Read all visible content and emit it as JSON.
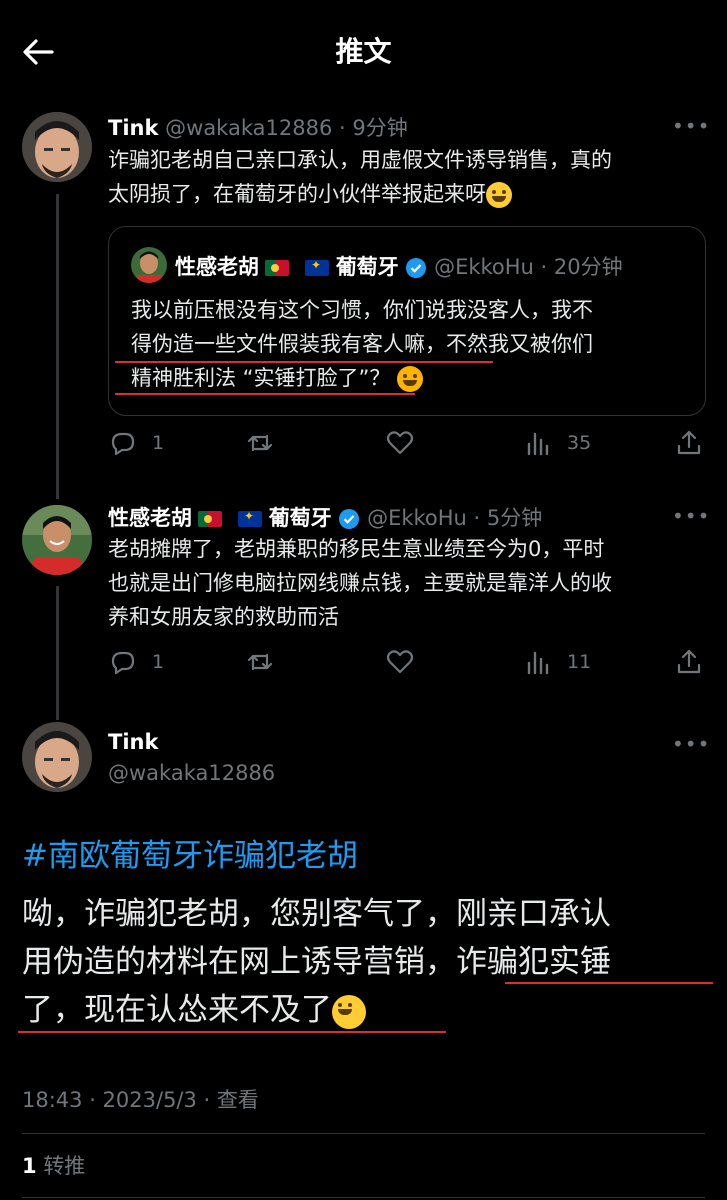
{
  "header": {
    "title": "推文"
  },
  "tweet1": {
    "name": "Tink",
    "handle_time": "@wakaka12886 · 9分钟",
    "text_line1": "诈骗犯老胡自己亲口承认，用虚假文件诱导销售，真的",
    "text_line2": "太阴损了，在葡萄牙的小伙伴举报起来呀",
    "more": "•••",
    "quote": {
      "name": "性感老胡",
      "name2": "葡萄牙",
      "handle_time": "@EkkoHu · 20分钟",
      "line1": "我以前压根没有这个习惯，你们说我没客人，我不",
      "line2": "得伪造一些文件假装我有客人嘛，不然我又被你们",
      "line3": "精神胜利法 “实锤打脸了”？"
    },
    "actions": {
      "replies": "1",
      "views": "35"
    }
  },
  "tweet2": {
    "name": "性感老胡",
    "name2": "葡萄牙",
    "handle_time": "@EkkoHu · 5分钟",
    "text_line1": "老胡摊牌了，老胡兼职的移民生意业绩至今为0，平时",
    "text_line2": "也就是出门修电脑拉网线赚点钱，主要就是靠洋人的收",
    "text_line3": "养和女朋友家的救助而活",
    "more": "•••",
    "actions": {
      "replies": "1",
      "views": "11"
    }
  },
  "main_tweet": {
    "name": "Tink",
    "handle": "@wakaka12886",
    "more": "•••",
    "hashtag": "#南欧葡萄牙诈骗犯老胡",
    "line1": "呦，诈骗犯老胡，您别客气了，刚亲口承认",
    "line2": "用伪造的材料在网上诱导营销，诈骗犯实锤",
    "line3": "了，现在认怂来不及了",
    "timestamp": "18:43 · 2023/5/3 · 查看",
    "retweet_count": "1",
    "retweet_label": "转推"
  },
  "colors": {
    "background": "#000000",
    "text": "#e7e9ea",
    "muted": "#71767b",
    "link": "#1d9bf0",
    "verified": "#1d9bf0",
    "annotation": "#d9302b"
  },
  "icons": [
    "back-arrow-icon",
    "more-icon",
    "reply-icon",
    "retweet-icon",
    "like-icon",
    "views-icon",
    "share-icon",
    "verified-icon"
  ]
}
